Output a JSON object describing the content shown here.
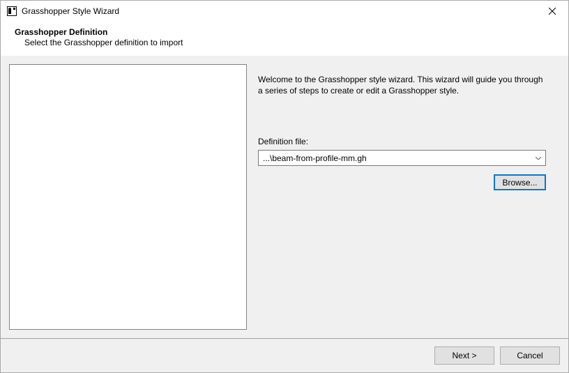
{
  "window": {
    "title": "Grasshopper Style Wizard"
  },
  "header": {
    "title": "Grasshopper Definition",
    "subtitle": "Select the Grasshopper definition to import"
  },
  "main": {
    "welcome_text": "Welcome to the Grasshopper style wizard. This wizard will guide you through a series of steps to create or edit a Grasshopper style.",
    "definition_label": "Definition file:",
    "definition_file": "...\\beam-from-profile-mm.gh",
    "browse_label": "Browse..."
  },
  "footer": {
    "next_label": "Next >",
    "cancel_label": "Cancel"
  }
}
